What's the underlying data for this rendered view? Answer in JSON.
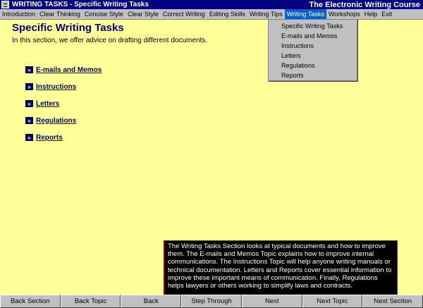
{
  "window": {
    "title": "WRITING TASKS - Specific Writing Tasks",
    "course_title": "The Electronic Writing Course"
  },
  "menu": [
    "Introduction",
    "Clear Thinking",
    "Concise Style",
    "Clear Style",
    "Correct Writing",
    "Editing Skills",
    "Writing Tips",
    "Writing Tasks",
    "Workshops",
    "Help",
    "Exit"
  ],
  "dropdown": [
    "Specific Writing Tasks",
    "E-mails and Memos",
    "Instructions",
    "Letters",
    "Regulations",
    "Reports"
  ],
  "page": {
    "title": "Specific Writing Tasks",
    "intro": "In this section, we offer advice on drafting different documents."
  },
  "topics": [
    "E-mails and Memos",
    "Instructions",
    "Letters",
    "Regulations",
    "Reports"
  ],
  "bullet_glyph": "»",
  "info_text": "The Writing Tasks Section looks at typical documents and how to improve them.  The E-mails and Memos Topic explains how to improve internal communications.  The Instructions Topic will help anyone writing manuals or technical documentation.  Letters and Reports cover essential information to improve these important means of communication.  Finally, Regulations helps lawyers or others working to simplify laws and contracts.",
  "nav_buttons": [
    "Back Section",
    "Back Topic",
    "Back",
    "Step Through",
    "Next",
    "Next Topic",
    "Next Section"
  ],
  "colors": {
    "titlebar": "#000080",
    "content_bg": "#ffff99",
    "heading": "#000080",
    "menu_active": "#0a5fd0"
  }
}
